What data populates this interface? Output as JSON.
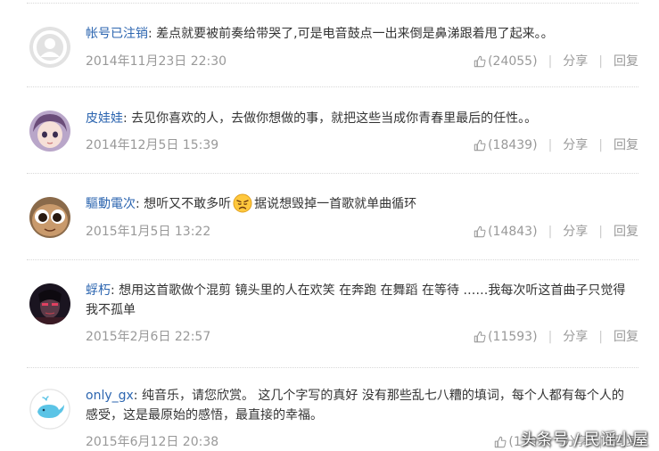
{
  "comments": [
    {
      "username": "帐号已注销",
      "separator": ": ",
      "text": "差点就要被前奏给带哭了,可是电音鼓点一出来倒是鼻涕跟着甩了起来。。",
      "timestamp": "2014年11月23日 22:30",
      "likes": "(24055)",
      "avatar": "default-user-icon"
    },
    {
      "username": "皮娃娃",
      "separator": ": ",
      "text": "去见你喜欢的人，去做你想做的事，就把这些当成你青春里最后的任性。。",
      "timestamp": "2014年12月5日 15:39",
      "likes": "(18439)",
      "avatar": "anime-girl-icon"
    },
    {
      "username": "驅動電次",
      "separator": ": ",
      "text_before": "想听又不敢多听",
      "emoji": "sad-face-emoji",
      "text_after": "据说想毁掉一首歌就单曲循环",
      "timestamp": "2015年1月5日 13:22",
      "likes": "(14843)",
      "avatar": "cartoon-eyes-icon"
    },
    {
      "username": "蜉朽",
      "separator": ": ",
      "text": "想用这首歌做个混剪 镜头里的人在欢笑 在奔跑 在舞蹈 在等待 ……我每次听这首曲子只觉得我不孤单",
      "timestamp": "2015年2月6日 22:57",
      "likes": "(11593)",
      "avatar": "dark-portrait-icon"
    },
    {
      "username": "only_gx",
      "separator": ": ",
      "text": "纯音乐，请您欣赏。 这几个字写的真好 没有那些乱七八糟的填词，每个人都有每个人的感受，这是最原始的感悟，最直接的幸福。",
      "timestamp": "2015年6月12日 20:38",
      "likes": "(110",
      "avatar": "whale-icon"
    }
  ],
  "actions": {
    "share": "分享",
    "reply": "回复",
    "separator": "|"
  },
  "watermark": "头条号 / 民谣小屋",
  "colors": {
    "username": "#2d66b0",
    "text": "#333333",
    "meta": "#999999",
    "divider": "#d8d8d8"
  }
}
